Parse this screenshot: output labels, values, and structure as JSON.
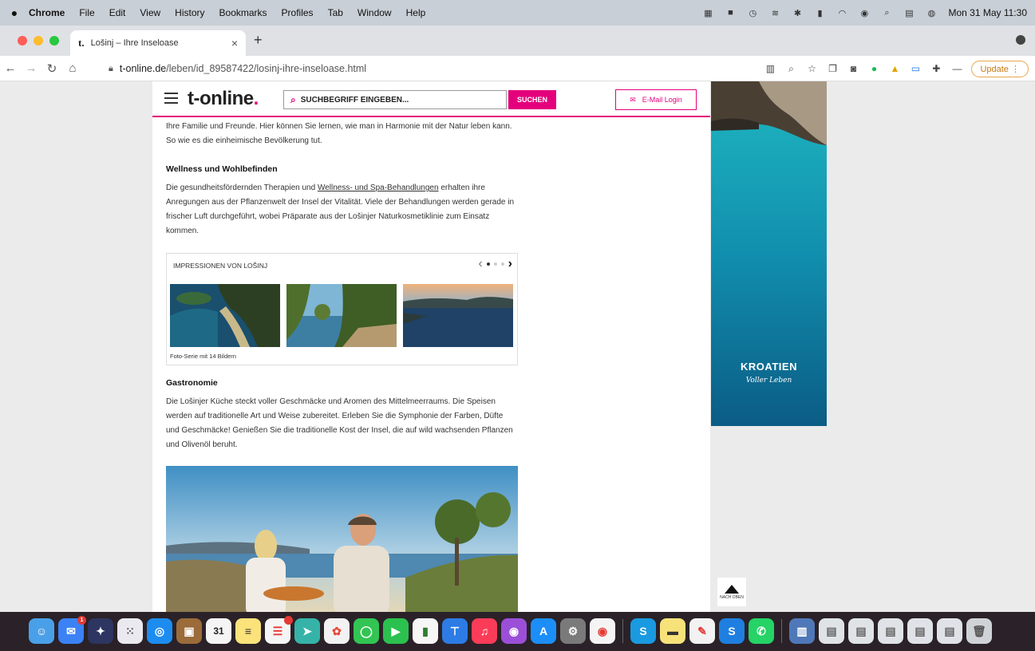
{
  "menubar": {
    "apple_icon": "apple-icon",
    "items": [
      "Chrome",
      "File",
      "Edit",
      "View",
      "History",
      "Bookmarks",
      "Profiles",
      "Tab",
      "Window",
      "Help"
    ],
    "clock": "Mon 31 May  11:30"
  },
  "tab": {
    "favicon": "t.",
    "title": "Lošinj – Ihre Inseloase",
    "close": "×",
    "new_tab": "+"
  },
  "toolbar": {
    "url_host": "t-online.de",
    "url_path": "/leben/id_89587422/losinj-ihre-inseloase.html",
    "update_label": "Update"
  },
  "site": {
    "logo_text": "t-online",
    "logo_dot": ".",
    "search_placeholder": "SUCHBEGRIFF EINGEBEN...",
    "search_button": "SUCHEN",
    "login_label": "E-Mail Login",
    "brand_color": "#e4007c"
  },
  "article": {
    "para_intro": "Ihre Familie und Freunde. Hier können Sie lernen, wie man in Harmonie mit der Natur leben kann. So wie es die einheimische Bevölkerung tut.",
    "heading_wellness": "Wellness und Wohlbefinden",
    "wellness_pre": "Die gesundheitsfördernden Therapien und ",
    "wellness_link": "Wellness- und Spa-Behandlungen",
    "wellness_post": " erhalten ihre Anregungen aus der Pflanzenwelt der Insel der Vitalität. Viele der Behandlungen werden gerade in frischer Luft durchgeführt, wobei Präparate aus der Lošinjer Naturkosmetiklinie zum Einsatz kommen.",
    "gallery_title": "IMPRESSIONEN VON LOŠINJ",
    "gallery_caption": "Foto-Serie mit 14 Bildern",
    "heading_gastro": "Gastronomie",
    "para_gastro": "Die Lošinjer Küche steckt voller Geschmäcke und Aromen des Mittelmeerraums. Die Speisen werden auf traditionelle Art und Weise zubereitet. Erleben Sie die Symphonie der Farben, Düfte und Geschmäcke! Genießen Sie die traditionelle Kost der Insel, die auf wild wachsenden Pflanzen und Olivenöl beruht."
  },
  "ad": {
    "brand": "KROATIEN",
    "slogan": "Voller Leben"
  },
  "back_to_top": "NACH OBEN",
  "dock": {
    "calendar_day": "31",
    "mail_badge": "1",
    "reminders_badge": "1"
  }
}
